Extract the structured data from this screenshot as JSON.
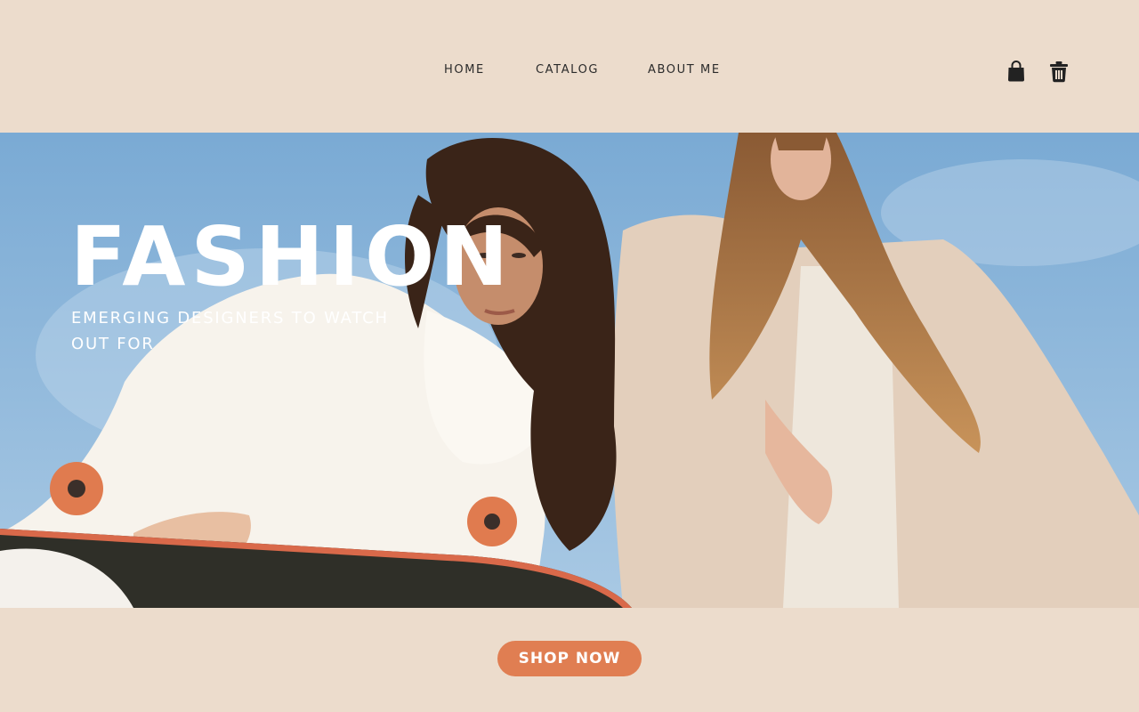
{
  "nav": {
    "home": "HOME",
    "catalog": "CATALOG",
    "about": "ABOUT ME"
  },
  "icons": {
    "cart": "shopping-bag-icon",
    "trash": "trash-icon"
  },
  "hero": {
    "title": "FASHION",
    "subtitle": "EMERGING DESIGNERS TO WATCH OUT FOR",
    "image": "photo of two women with a skateboard against a blue sky"
  },
  "cta": {
    "label": "SHOP NOW"
  },
  "colors": {
    "background": "#ecdccc",
    "accent": "#e07e52",
    "text": "#2b2b2b",
    "sky": "#8fb8dc"
  }
}
